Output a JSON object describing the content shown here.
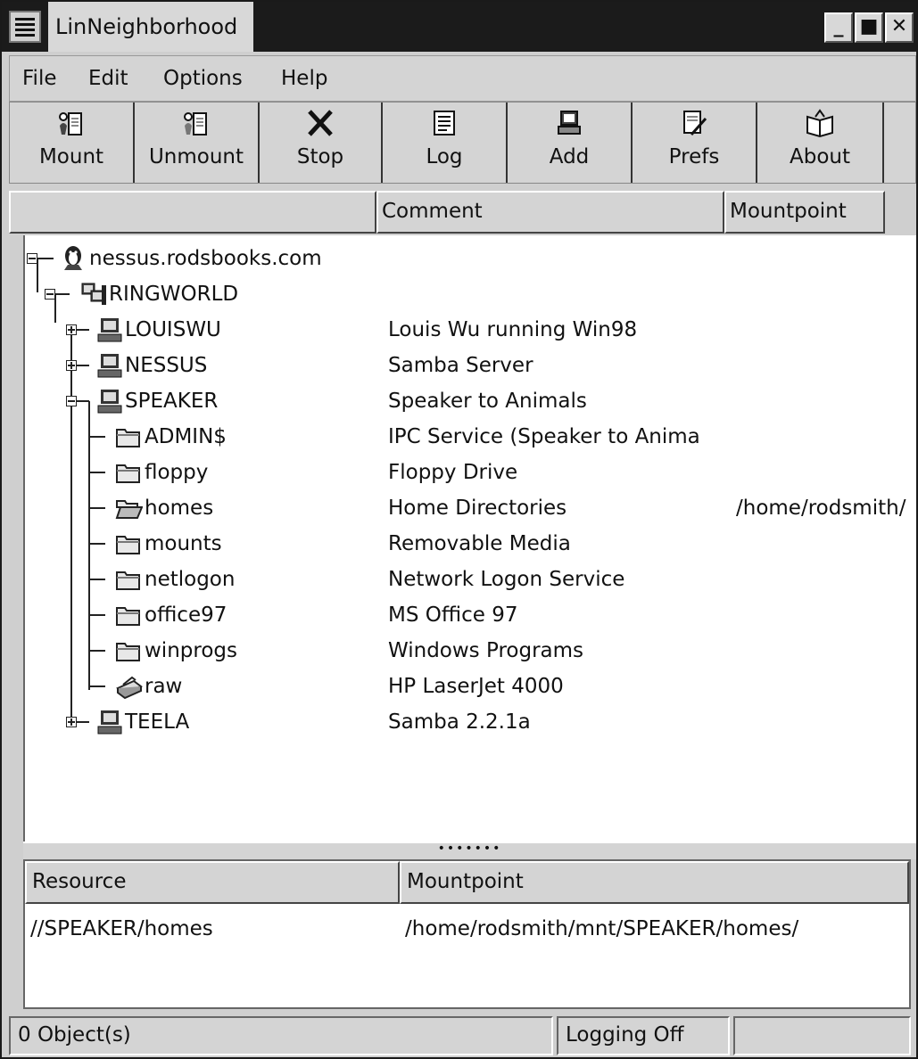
{
  "window": {
    "title": "LinNeighborhood"
  },
  "menu": {
    "file": "File",
    "edit": "Edit",
    "options": "Options",
    "help": "Help"
  },
  "toolbar": {
    "mount": "Mount",
    "unmount": "Unmount",
    "stop": "Stop",
    "log": "Log",
    "add": "Add",
    "prefs": "Prefs",
    "about": "About"
  },
  "columns": {
    "name": "",
    "comment": "Comment",
    "mountpoint": "Mountpoint"
  },
  "tree": {
    "host": "nessus.rodsbooks.com",
    "workgroup": "RINGWORLD",
    "machines": [
      {
        "name": "LOUISWU",
        "comment": "Louis Wu running Win98",
        "expanded": false
      },
      {
        "name": "NESSUS",
        "comment": "Samba Server",
        "expanded": false
      },
      {
        "name": "SPEAKER",
        "comment": "Speaker to Animals",
        "expanded": true
      },
      {
        "name": "TEELA",
        "comment": "Samba 2.2.1a",
        "expanded": false
      }
    ],
    "shares": [
      {
        "name": "ADMIN$",
        "comment": "IPC Service (Speaker to Anima",
        "mountpoint": "",
        "icon": "folder-icon"
      },
      {
        "name": "floppy",
        "comment": "Floppy Drive",
        "mountpoint": "",
        "icon": "folder-icon"
      },
      {
        "name": "homes",
        "comment": "Home Directories",
        "mountpoint": "/home/rodsmith/",
        "icon": "open-folder-icon"
      },
      {
        "name": "mounts",
        "comment": "Removable Media",
        "mountpoint": "",
        "icon": "folder-icon"
      },
      {
        "name": "netlogon",
        "comment": "Network Logon Service",
        "mountpoint": "",
        "icon": "folder-icon"
      },
      {
        "name": "office97",
        "comment": "MS Office 97",
        "mountpoint": "",
        "icon": "folder-icon"
      },
      {
        "name": "winprogs",
        "comment": "Windows Programs",
        "mountpoint": "",
        "icon": "folder-icon"
      },
      {
        "name": "raw",
        "comment": "HP LaserJet 4000",
        "mountpoint": "",
        "icon": "printer-icon"
      }
    ]
  },
  "lower": {
    "col_resource": "Resource",
    "col_mountpoint": "Mountpoint",
    "rows": [
      {
        "resource": "//SPEAKER/homes",
        "mountpoint": "/home/rodsmith/mnt/SPEAKER/homes/"
      }
    ]
  },
  "status": {
    "objects": "0 Object(s)",
    "logging": "Logging Off",
    "extra": ""
  },
  "colors": {
    "titlebar": "#1b1b1b",
    "chrome": "#d4d4d4",
    "pane": "#ffffff"
  }
}
